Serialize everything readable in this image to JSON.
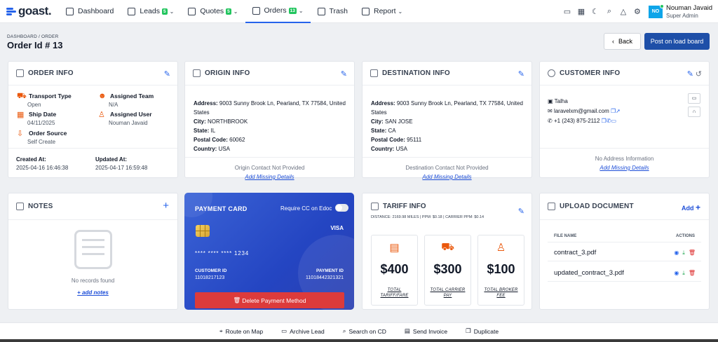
{
  "app": {
    "logo": "goast."
  },
  "nav": {
    "items": [
      {
        "label": "Dashboard",
        "icon": "home-icon"
      },
      {
        "label": "Leads",
        "badge": "5",
        "icon": "card-icon"
      },
      {
        "label": "Quotes",
        "badge": "5",
        "icon": "quote-icon"
      },
      {
        "label": "Orders",
        "badge": "13",
        "icon": "orders-icon",
        "active": true
      },
      {
        "label": "Trash",
        "icon": "trash-icon"
      },
      {
        "label": "Report",
        "icon": "report-icon"
      }
    ]
  },
  "user": {
    "initials": "NO",
    "name": "Nouman Javaid",
    "role": "Super Admin"
  },
  "header": {
    "breadcrumb": "DASHBOARD / ORDER",
    "title": "Order Id # 13",
    "back_label": "Back",
    "post_label": "Post on load board"
  },
  "order_info": {
    "title": "ORDER INFO",
    "transport_type_label": "Transport Type",
    "transport_type": "Open",
    "ship_date_label": "Ship Date",
    "ship_date": "04/11/2025",
    "order_source_label": "Order Source",
    "order_source": "Self Create",
    "assigned_team_label": "Assigned Team",
    "assigned_team": "N/A",
    "assigned_user_label": "Assigned User",
    "assigned_user": "Nouman Javaid",
    "created_label": "Created At:",
    "created": "2025-04-16 16:46:38",
    "updated_label": "Updated At:",
    "updated": "2025-04-17 16:59:48"
  },
  "origin": {
    "title": "ORIGIN INFO",
    "address_label": "Address:",
    "address": "9003 Sunny Brook Ln, Pearland, TX 77584, United States",
    "city_label": "City:",
    "city": "NORTHBROOK",
    "state_label": "State:",
    "state": "IL",
    "postal_label": "Postal Code:",
    "postal": "60062",
    "country_label": "Country:",
    "country": "USA",
    "contact_note": "Origin Contact Not Provided",
    "add_link": "Add Missing Details"
  },
  "destination": {
    "title": "DESTINATION INFO",
    "address_label": "Address:",
    "address": "9003 Sunny Brook Ln, Pearland, TX 77584, United States",
    "city_label": "City:",
    "city": "SAN JOSE",
    "state_label": "State:",
    "state": "CA",
    "postal_label": "Postal Code:",
    "postal": "95111",
    "country_label": "Country:",
    "country": "USA",
    "contact_note": "Destination Contact Not Provided",
    "add_link": "Add Missing Details"
  },
  "customer": {
    "title": "CUSTOMER INFO",
    "name": "Talha",
    "email": "laravelxm@gmail.com",
    "phone": "+1 (243) 875-2112",
    "address_note": "No Address Information",
    "add_link": "Add Missing Details"
  },
  "notes": {
    "title": "NOTES",
    "empty": "No records found",
    "add_link": "+ add notes"
  },
  "payment": {
    "title": "PAYMENT CARD",
    "require_label": "Require CC on Edoc",
    "brand": "VISA",
    "number": "**** **** **** 1234",
    "customer_id_label": "CUSTOMER ID",
    "customer_id": "11018217123",
    "payment_id_label": "PAYMENT ID",
    "payment_id": "11018442321321",
    "delete_label": "Delete Payment Method"
  },
  "tariff": {
    "title": "TARIFF INFO",
    "summary": "DISTANCE: 2169.98 MILES | PPM: $0.18 | CARRIER PPM: $0.14",
    "boxes": [
      {
        "value": "$400",
        "label": "TOTAL TARIFF/FARE"
      },
      {
        "value": "$300",
        "label": "TOTAL CARRIER PAY"
      },
      {
        "value": "$100",
        "label": "TOTAL BROKER FEE"
      }
    ]
  },
  "upload": {
    "title": "UPLOAD DOCUMENT",
    "add_label": "Add",
    "col_file": "FILE NAME",
    "col_actions": "ACTIONS",
    "files": [
      "contract_3.pdf",
      "updated_contract_3.pdf"
    ]
  },
  "bottom": {
    "route": "Route on Map",
    "archive": "Archive Lead",
    "search": "Search on CD",
    "send": "Send Invoice",
    "duplicate": "Duplicate"
  },
  "colors": {
    "accent": "#2563eb",
    "primary_button": "#1e4fa8",
    "orange_icon": "#ea580c",
    "danger": "#dc3b3b",
    "badge": "#22c55e"
  }
}
